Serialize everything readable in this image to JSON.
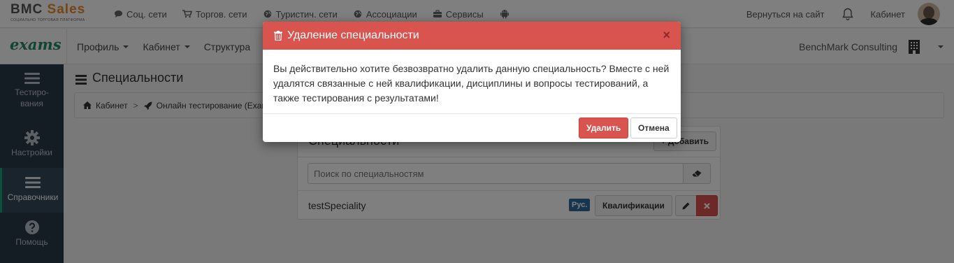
{
  "brand": {
    "name_part1": "BMC",
    "name_part2": " Sales",
    "subtitle": "СОЦИАЛЬНО ТОРГОВАЯ ПЛАТФОРМА"
  },
  "topnav": {
    "items": [
      {
        "label": "Соц. сети",
        "icon": "comment-icon"
      },
      {
        "label": "Торгов. сети",
        "icon": "cart-icon"
      },
      {
        "label": "Туристич. сети",
        "icon": "globe-icon"
      },
      {
        "label": "Ассоциации",
        "icon": "globe-icon"
      },
      {
        "label": "Сервисы",
        "icon": "briefcase-icon"
      }
    ],
    "return_link": "Вернуться на сайт",
    "cabinet_link": "Кабинет"
  },
  "secondbar": {
    "logo": "exams",
    "menu": [
      {
        "label": "Профиль",
        "dropdown": true
      },
      {
        "label": "Кабинет",
        "dropdown": true
      },
      {
        "label": "Структура",
        "dropdown": false
      }
    ],
    "company": "BenchMark Consulting"
  },
  "sidebar": {
    "items": [
      {
        "label": "Тестиро-вания",
        "label_line1": "Тестиро-",
        "label_line2": "вания",
        "icon": "bars-icon"
      },
      {
        "label": "Настройки",
        "icon": "gear-icon"
      },
      {
        "label": "Справочники",
        "icon": "bars-icon",
        "active": true
      },
      {
        "label": "Помощь",
        "icon": "question-icon"
      }
    ]
  },
  "page": {
    "title": "Специальности",
    "breadcrumb": [
      {
        "label": "Кабинет",
        "icon": "home-icon"
      },
      {
        "label": "Онлайн тестирование (Exams)",
        "icon": "rocket-icon"
      }
    ]
  },
  "panel": {
    "title": "Специальности",
    "add_label": "+ Добавить",
    "search_placeholder": "Поиск по специальностям",
    "rows": [
      {
        "name": "testSpeciality",
        "lang": "Рус.",
        "qual_label": "Квалификации"
      }
    ]
  },
  "modal": {
    "title": "Удаление специальности",
    "close": "×",
    "body": "Вы действительно хотите безвозвратно удалить данную специальность? Вместе с ней удалятся связанные с ней квалификации, дисциплины и вопросы тестирований, а также тестирования с результатами!",
    "delete_label": "Удалить",
    "cancel_label": "Отмена"
  },
  "colors": {
    "danger": "#d9534f",
    "sidebar": "#2b3a48",
    "accent": "#1ba37a",
    "brand_orange": "#e88a2a"
  }
}
